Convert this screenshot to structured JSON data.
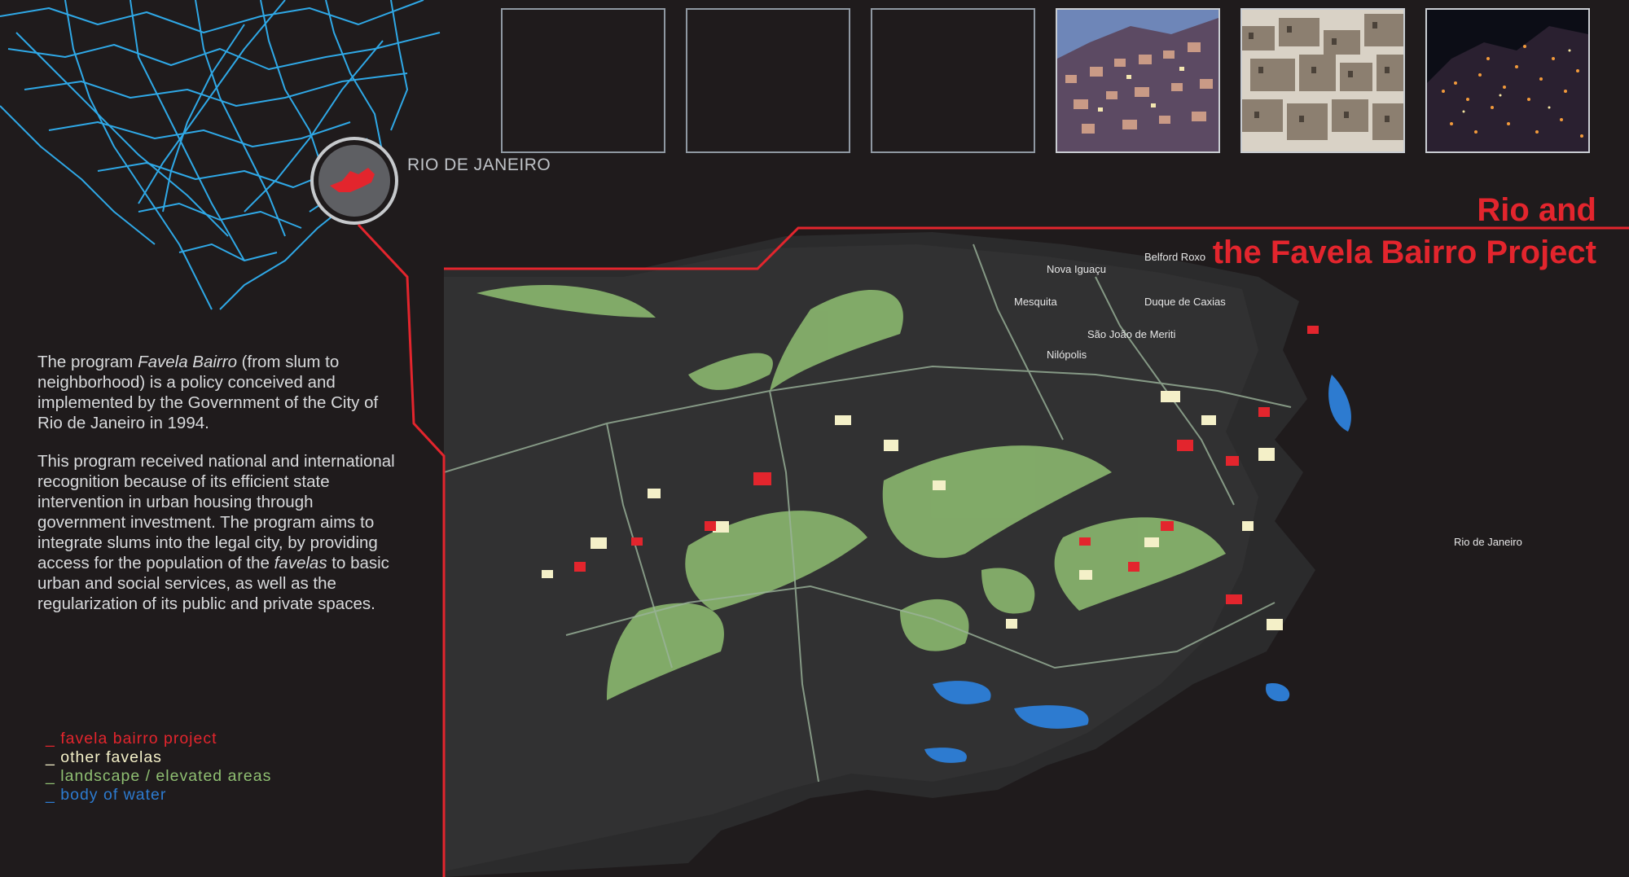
{
  "location": {
    "label": "RIO DE JANEIRO"
  },
  "title": {
    "line1": "Rio and",
    "line2": "the Favela Bairro Project"
  },
  "description": {
    "p1_pre": "The program ",
    "p1_em": "Favela Bairro",
    "p1_post": " (from slum to neighborhood) is a policy conceived and implemented by the Government of the City of Rio de Janeiro in 1994.",
    "p2_pre": "This program received national and international recognition because of its efficient state intervention in urban housing through government investment. The program aims to integrate slums into the legal city, by providing access for the population of the ",
    "p2_em": "favelas",
    "p2_post": " to basic urban and social services, as well as the regularization of its public and private spaces."
  },
  "legend": [
    {
      "label": "favela bairro project",
      "color": "#e3252d"
    },
    {
      "label": "other favelas",
      "color": "#f4f0c8"
    },
    {
      "label": "landscape / elevated areas",
      "color": "#8fbf72"
    },
    {
      "label": "body of water",
      "color": "#2d7bd0"
    }
  ],
  "map_labels": {
    "nova_iguacu": "Nova Iguaçu",
    "duque_de_caxias": "Duque de Caxias",
    "sao_joao_de_meriti": "São João de Meriti",
    "rio_de_janeiro": "Rio de Janeiro",
    "nilopolis": "Nilópolis",
    "mesquita": "Mesquita",
    "belford_roxo": "Belford Roxo"
  },
  "colors": {
    "accent": "#e3252d",
    "background": "#1f1b1c",
    "brazil_roads": "#2fa8e6"
  }
}
